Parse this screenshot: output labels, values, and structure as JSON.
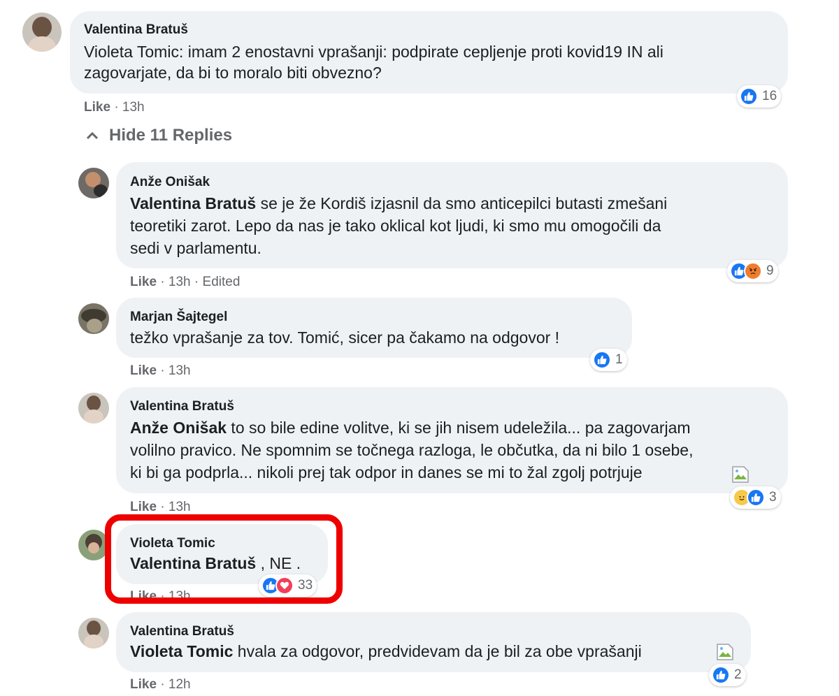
{
  "comments": [
    {
      "author": "Valentina Bratuš",
      "lines": [
        "Violeta Tomic: imam 2 enostavni vprašanji: podpirate cepljenje proti kovid19 IN ali",
        "zagovarjate, da bi to moralo biti obvezno?"
      ],
      "like_label": "Like",
      "time": "13h",
      "reaction_count": "16"
    },
    {
      "author": "Anže Onišak",
      "mention": "Valentina Bratuš",
      "lines": [
        " se je že Kordiš izjasnil da smo anticepilci butasti zmešani",
        "teoretiki zarot. Lepo da nas je tako oklical kot ljudi, ki smo mu omogočili da",
        "sedi v parlamentu."
      ],
      "like_label": "Like",
      "time": "13h",
      "edited": "Edited",
      "reaction_count": "9"
    },
    {
      "author": "Marjan Šajtegel",
      "lines": [
        "težko vprašanje za tov. Tomić, sicer pa čakamo na odgovor !"
      ],
      "like_label": "Like",
      "time": "13h",
      "reaction_count": "1"
    },
    {
      "author": "Valentina Bratuš",
      "mention": "Anže Onišak",
      "lines": [
        " to so bile edine volitve, ki se jih nisem udeležila... pa zagovarjam",
        "volilno pravico. Ne spomnim se točnega razloga, le občutka, da ni bilo 1 osebe,",
        "ki bi ga podprla... nikoli prej tak odpor in danes se mi to žal zgolj potrjuje"
      ],
      "like_label": "Like",
      "time": "13h",
      "reaction_count": "3"
    },
    {
      "author": "Violeta Tomic",
      "mention": "Valentina Bratuš",
      "lines": [
        " , NE ."
      ],
      "like_label": "Like",
      "time": "13h",
      "reaction_count": "33"
    },
    {
      "author": "Valentina Bratuš",
      "mention": "Violeta Tomic",
      "lines": [
        " hvala za odgovor, predvidevam da je bil za obe vprašanji"
      ],
      "like_label": "Like",
      "time": "12h",
      "reaction_count": "2"
    }
  ],
  "hide_replies_label": "Hide 11 Replies",
  "separator": "·",
  "colors": {
    "bubble": "#eff2f5",
    "like_blue": "#1877f2",
    "angry_orange": "#f07d2f",
    "love_red": "#f33e58",
    "care_yellow": "#f7c94a",
    "highlight": "#ee0000",
    "meta_gray": "#65676b"
  },
  "icons": [
    "like-icon",
    "angry-icon",
    "love-icon",
    "care-icon",
    "chevron-up-icon",
    "broken-image-icon"
  ]
}
